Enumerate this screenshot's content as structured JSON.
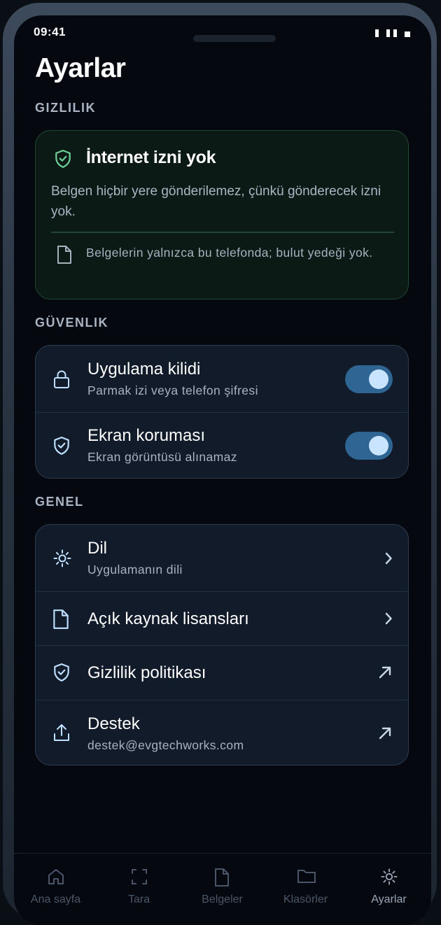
{
  "status_bar": {
    "time": "09:41"
  },
  "page": {
    "title": "Ayarlar"
  },
  "privacy": {
    "section_label": "GIZLILIK",
    "title": "İnternet izni yok",
    "body": "Belgen hiçbir yere gönderilemez, çünkü gönderecek izni yok.",
    "note": "Belgelerin yalnızca bu telefonda; bulut yedeği yok.",
    "accent_color": "#6fd39a"
  },
  "security": {
    "section_label": "GÜVENLIK",
    "items": [
      {
        "title": "Uygulama kilidi",
        "subtitle": "Parmak izi veya telefon şifresi",
        "icon": "lock-icon",
        "enabled": true
      },
      {
        "title": "Ekran koruması",
        "subtitle": "Ekran görüntüsü alınamaz",
        "icon": "shield-check-icon",
        "enabled": true
      }
    ]
  },
  "general": {
    "section_label": "GENEL",
    "items": [
      {
        "title": "Dil",
        "subtitle": "Uygulamanın dili",
        "icon": "sun-icon",
        "trailing": "chevron-right-icon"
      },
      {
        "title": "Açık kaynak lisansları",
        "icon": "document-icon",
        "trailing": "chevron-right-icon"
      },
      {
        "title": "Gizlilik politikası",
        "icon": "shield-check-icon",
        "trailing": "external-arrow-icon"
      },
      {
        "title": "Destek",
        "subtitle": "destek@evgtechworks.com",
        "icon": "share-icon",
        "trailing": "external-arrow-icon"
      }
    ]
  },
  "tab_bar": {
    "tabs": [
      {
        "label": "Ana sayfa",
        "icon": "home-icon"
      },
      {
        "label": "Tara",
        "icon": "scan-icon"
      },
      {
        "label": "Belgeler",
        "icon": "document-icon"
      },
      {
        "label": "Klasörler",
        "icon": "folder-icon"
      },
      {
        "label": "Ayarlar",
        "icon": "gear-icon",
        "active": true
      }
    ]
  },
  "colors": {
    "background": "#05090f",
    "card": "#111b2a",
    "toggle_on": "#2f6593",
    "icon_blue": "#bfe0ff"
  }
}
